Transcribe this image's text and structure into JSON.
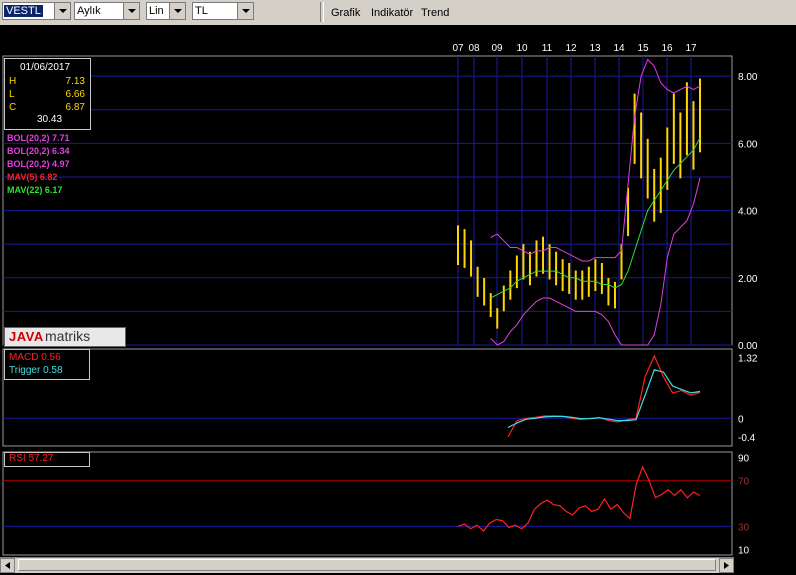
{
  "toolbar": {
    "symbol": "VESTL",
    "period": "Aylık",
    "scale": "Lin",
    "currency": "TL",
    "menus": [
      "Grafik",
      "Indikatör",
      "Trend"
    ]
  },
  "info": {
    "date": "01/06/2017",
    "rows": [
      {
        "label": "H",
        "value": "7.13"
      },
      {
        "label": "L",
        "value": "6.66"
      },
      {
        "label": "C",
        "value": "6.87"
      }
    ],
    "volume": "30.43"
  },
  "indicators": [
    {
      "text": "BOL(20,2) 7.71",
      "color": "#e040e0"
    },
    {
      "text": "BOL(20,2) 6.34",
      "color": "#e040e0"
    },
    {
      "text": "BOL(20,2) 4.97",
      "color": "#e040e0"
    },
    {
      "text": "MAV(5) 6.82",
      "color": "#ff2020"
    },
    {
      "text": "MAV(22) 6.17",
      "color": "#30e030"
    }
  ],
  "logo": {
    "part1": "JAVA",
    "part2": "matriks"
  },
  "macd": {
    "macd_label": "MACD 0.56",
    "trigger_label": "Trigger 0.58"
  },
  "rsi": {
    "label": "RSI 57.27"
  },
  "colors": {
    "grid": "#1a1aa0",
    "candle": "#ffd700",
    "bollinger": "#e040e0",
    "mav5": "#ff2020",
    "mav22": "#30e030",
    "macd": "#ff2020",
    "trigger": "#40e0e0",
    "rsi": "#ff2020",
    "rsi_ref": "#a00000"
  },
  "chart_data": [
    {
      "type": "line",
      "panel": "price",
      "x_ticks": [
        "07",
        "08",
        "09",
        "10",
        "11",
        "12",
        "13",
        "14",
        "15",
        "16",
        "17"
      ],
      "y_ticks": [
        "8.00",
        "6.00",
        "4.00",
        "2.00",
        "0.00"
      ],
      "ylim": [
        0,
        8.6
      ],
      "series": [
        {
          "key": "close",
          "values": [
            3.0,
            2.9,
            2.6,
            1.9,
            1.6,
            1.2,
            0.8,
            1.4,
            1.8,
            2.2,
            2.5,
            2.3,
            2.6,
            2.7,
            2.5,
            2.3,
            2.1,
            2.0,
            1.8,
            1.8,
            1.9,
            2.1,
            2.0,
            1.6,
            1.5,
            2.5,
            4.0,
            6.5,
            6.0,
            5.3,
            4.5,
            4.8,
            5.6,
            6.5,
            6.0,
            6.8,
            6.3,
            6.9
          ]
        },
        {
          "key": "bol_upper",
          "values": [
            null,
            null,
            null,
            null,
            null,
            3.2,
            3.3,
            3.1,
            2.9,
            2.9,
            2.8,
            2.7,
            2.8,
            2.8,
            2.9,
            2.9,
            2.8,
            2.7,
            2.6,
            2.5,
            2.5,
            2.6,
            2.6,
            2.6,
            2.6,
            2.8,
            4.8,
            6.8,
            8.0,
            8.5,
            8.3,
            7.8,
            7.6,
            7.5,
            7.6,
            7.7,
            7.6,
            7.71
          ]
        },
        {
          "key": "bol_lower",
          "values": [
            null,
            null,
            null,
            null,
            null,
            0.2,
            0.0,
            0.1,
            0.4,
            0.6,
            0.9,
            1.1,
            1.3,
            1.4,
            1.4,
            1.3,
            1.2,
            1.1,
            1.0,
            1.0,
            1.0,
            1.0,
            0.9,
            0.7,
            0.3,
            0.0,
            0.0,
            0.0,
            0.0,
            0.0,
            0.3,
            1.2,
            2.6,
            3.3,
            3.5,
            3.7,
            4.2,
            4.97
          ]
        },
        {
          "key": "mav22",
          "values": [
            null,
            null,
            null,
            null,
            null,
            1.4,
            1.5,
            1.6,
            1.7,
            1.9,
            2.0,
            2.1,
            2.2,
            2.2,
            2.2,
            2.2,
            2.1,
            2.0,
            2.0,
            1.9,
            1.9,
            1.9,
            1.8,
            1.8,
            1.7,
            1.8,
            2.2,
            2.8,
            3.4,
            4.0,
            4.3,
            4.6,
            4.9,
            5.2,
            5.4,
            5.6,
            5.8,
            6.17
          ]
        }
      ]
    },
    {
      "type": "line",
      "panel": "macd",
      "y_ticks": [
        "1.32",
        "0",
        "-0.4"
      ],
      "ylim": [
        -0.6,
        1.5
      ],
      "series": [
        {
          "key": "macd",
          "values": [
            -0.4,
            -0.05,
            0.0,
            0.02,
            0.05,
            0.05,
            0.04,
            0.0,
            -0.03,
            0.0,
            0.02,
            -0.05,
            -0.08,
            -0.03,
            0.0,
            0.9,
            1.35,
            0.9,
            0.55,
            0.6,
            0.5,
            0.56
          ]
        },
        {
          "key": "trigger",
          "values": [
            -0.2,
            -0.1,
            -0.02,
            0.0,
            0.03,
            0.04,
            0.04,
            0.02,
            -0.01,
            -0.01,
            0.01,
            -0.02,
            -0.05,
            -0.05,
            -0.03,
            0.5,
            1.05,
            1.0,
            0.7,
            0.62,
            0.55,
            0.58
          ]
        }
      ]
    },
    {
      "type": "line",
      "panel": "rsi",
      "y_ticks": [
        "90",
        "70",
        "30",
        "10"
      ],
      "ylim": [
        5,
        95
      ],
      "series": [
        {
          "key": "rsi",
          "values": [
            30,
            32,
            28,
            31,
            26,
            33,
            36,
            35,
            29,
            31,
            28,
            33,
            45,
            50,
            53,
            49,
            48,
            43,
            40,
            46,
            48,
            43,
            45,
            54,
            45,
            49,
            42,
            37,
            67,
            82,
            70,
            55,
            58,
            62,
            57,
            62,
            55,
            60,
            57
          ]
        }
      ]
    }
  ]
}
